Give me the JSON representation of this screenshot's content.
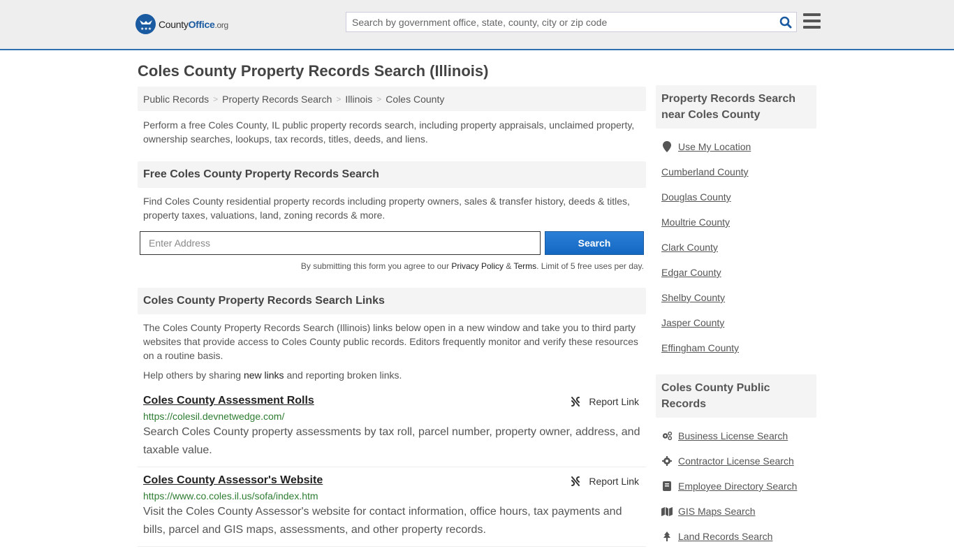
{
  "header": {
    "logo": {
      "county": "County",
      "office": "Office",
      "org": ".org"
    },
    "search_placeholder": "Search by government office, state, county, city or zip code",
    "search_icon": "search-icon",
    "menu_icon": "hamburger-menu-icon"
  },
  "page": {
    "title": "Coles County Property Records Search (Illinois)",
    "breadcrumb": [
      "Public Records",
      "Property Records Search",
      "Illinois",
      "Coles County"
    ],
    "breadcrumb_separator": ">",
    "intro": "Perform a free Coles County, IL public property records search, including property appraisals, unclaimed property, ownership searches, lookups, tax records, titles, deeds, and liens."
  },
  "free_search": {
    "heading": "Free Coles County Property Records Search",
    "description": "Find Coles County residential property records including property owners, sales & transfer history, deeds & titles, property taxes, valuations, land, zoning records & more.",
    "address_placeholder": "Enter Address",
    "search_button": "Search",
    "terms_prefix": "By submitting this form you agree to our ",
    "privacy_link": "Privacy Policy",
    "amp": " & ",
    "terms_link": "Terms",
    "terms_suffix": ". Limit of 5 free uses per day."
  },
  "links_section": {
    "heading": "Coles County Property Records Search Links",
    "description": "The Coles County Property Records Search (Illinois) links below open in a new window and take you to third party websites that provide access to Coles County public records. Editors frequently monitor and verify these resources on a routine basis.",
    "help_prefix": "Help others by sharing ",
    "help_link": "new links",
    "help_suffix": " and reporting broken links.",
    "report_label": "Report Link",
    "items": [
      {
        "title": "Coles County Assessment Rolls",
        "url": "https://colesil.devnetwedge.com/",
        "description": "Search Coles County property assessments by tax roll, parcel number, property owner, address, and taxable value."
      },
      {
        "title": "Coles County Assessor's Website",
        "url": "https://www.co.coles.il.us/sofa/index.htm",
        "description": "Visit the Coles County Assessor's website for contact information, office hours, tax payments and bills, parcel and GIS maps, assessments, and other property records."
      }
    ]
  },
  "sidebar": {
    "nearby_heading": "Property Records Search near Coles County",
    "use_location": "Use My Location",
    "nearby": [
      "Cumberland County",
      "Douglas County",
      "Moultrie County",
      "Clark County",
      "Edgar County",
      "Shelby County",
      "Jasper County",
      "Effingham County"
    ],
    "public_records_heading": "Coles County Public Records",
    "public_records": [
      {
        "label": "Business License Search",
        "icon": "cogs-icon"
      },
      {
        "label": "Contractor License Search",
        "icon": "gear-icon"
      },
      {
        "label": "Employee Directory Search",
        "icon": "book-icon"
      },
      {
        "label": "GIS Maps Search",
        "icon": "map-icon"
      },
      {
        "label": "Land Records Search",
        "icon": "tree-icon"
      }
    ]
  },
  "colors": {
    "brand": "#1a5aa0",
    "url_green": "#2e7d32",
    "button": "#1568c2"
  }
}
